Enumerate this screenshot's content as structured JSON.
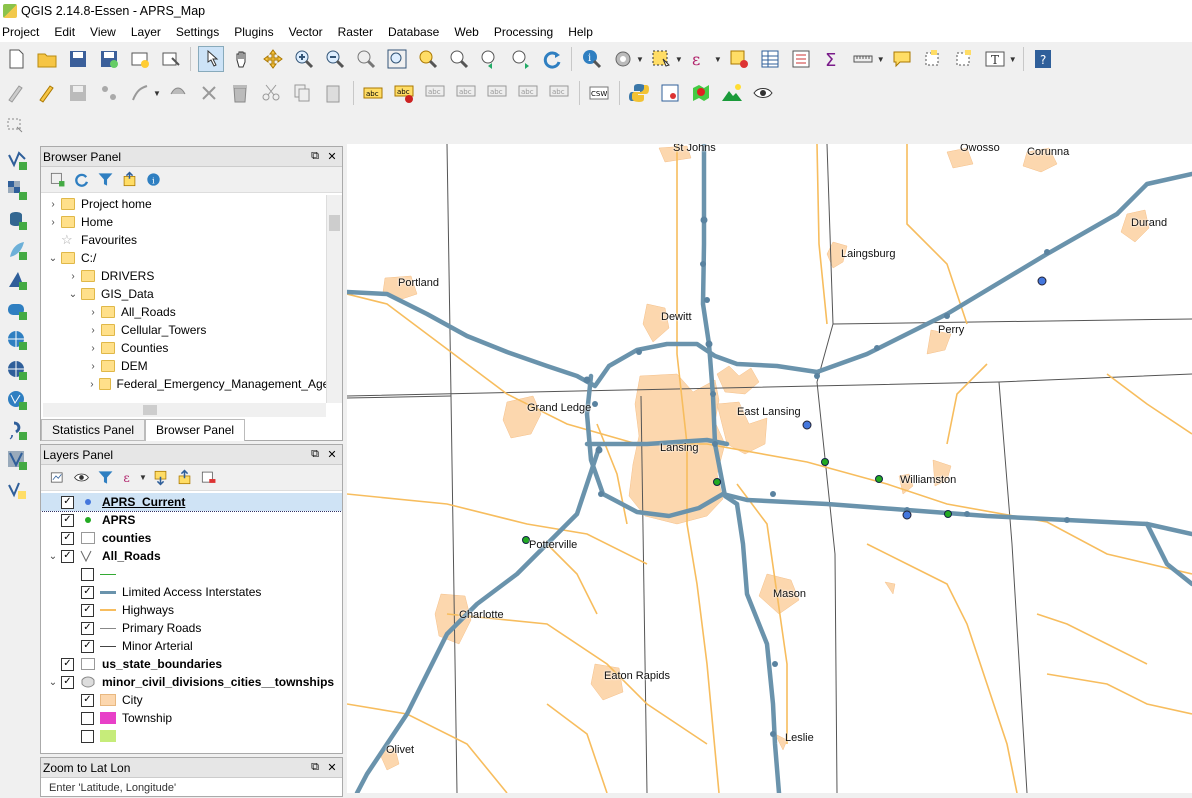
{
  "window": {
    "title": "QGIS 2.14.8-Essen - APRS_Map"
  },
  "menu": [
    "Project",
    "Edit",
    "View",
    "Layer",
    "Settings",
    "Plugins",
    "Vector",
    "Raster",
    "Database",
    "Web",
    "Processing",
    "Help"
  ],
  "browser_panel": {
    "title": "Browser Panel",
    "items": [
      {
        "label": "Project home",
        "level": 0,
        "expand": ">"
      },
      {
        "label": "Home",
        "level": 0,
        "expand": ">"
      },
      {
        "label": "Favourites",
        "level": 0,
        "expand": ""
      },
      {
        "label": "C:/",
        "level": 0,
        "expand": "v"
      },
      {
        "label": "DRIVERS",
        "level": 1,
        "expand": ">"
      },
      {
        "label": "GIS_Data",
        "level": 1,
        "expand": "v"
      },
      {
        "label": "All_Roads",
        "level": 2,
        "expand": ">"
      },
      {
        "label": "Cellular_Towers",
        "level": 2,
        "expand": ">"
      },
      {
        "label": "Counties",
        "level": 2,
        "expand": ">"
      },
      {
        "label": "DEM",
        "level": 2,
        "expand": ">"
      },
      {
        "label": "Federal_Emergency_Management_Agenc",
        "level": 2,
        "expand": ">"
      }
    ],
    "tabs": [
      "Statistics Panel",
      "Browser Panel"
    ]
  },
  "layers_panel": {
    "title": "Layers Panel",
    "items": [
      {
        "label": "APRS_Current",
        "level": 0,
        "bold": true,
        "checked": true,
        "expand": "",
        "sym": "blue-dot",
        "selected": true
      },
      {
        "label": "APRS",
        "level": 0,
        "bold": true,
        "checked": true,
        "expand": "",
        "sym": "green-dot"
      },
      {
        "label": "counties",
        "level": 0,
        "bold": true,
        "checked": true,
        "expand": "",
        "sym": "empty-box"
      },
      {
        "label": "All_Roads",
        "level": 0,
        "bold": true,
        "checked": true,
        "expand": "v",
        "sym": "line-icon"
      },
      {
        "label": "",
        "level": 1,
        "bold": false,
        "checked": false,
        "expand": "",
        "sym": "thin-green-line"
      },
      {
        "label": "Limited Access Interstates",
        "level": 1,
        "bold": false,
        "checked": true,
        "expand": "",
        "sym": "thick-blue-line"
      },
      {
        "label": "Highways",
        "level": 1,
        "bold": false,
        "checked": true,
        "expand": "",
        "sym": "orange-line"
      },
      {
        "label": "Primary Roads",
        "level": 1,
        "bold": false,
        "checked": true,
        "expand": "",
        "sym": "gray-line"
      },
      {
        "label": "Minor Arterial",
        "level": 1,
        "bold": false,
        "checked": true,
        "expand": "",
        "sym": "dark-line"
      },
      {
        "label": "us_state_boundaries",
        "level": 0,
        "bold": true,
        "checked": true,
        "expand": "",
        "sym": "empty-box"
      },
      {
        "label": "minor_civil_divisions_cities__townships",
        "level": 0,
        "bold": true,
        "checked": true,
        "expand": "v",
        "sym": "poly-icon"
      },
      {
        "label": "City",
        "level": 1,
        "bold": false,
        "checked": true,
        "expand": "",
        "sym": "peach-fill"
      },
      {
        "label": "Township",
        "level": 1,
        "bold": false,
        "checked": false,
        "expand": "",
        "sym": "magenta-fill"
      },
      {
        "label": "",
        "level": 1,
        "bold": false,
        "checked": false,
        "expand": "",
        "sym": "lime-fill"
      }
    ]
  },
  "zoom_panel": {
    "title": "Zoom to Lat Lon",
    "hint": "Enter 'Latitude, Longitude'"
  },
  "map": {
    "colors": {
      "interstate": "#6a93ac",
      "highway": "#f7bd5e",
      "city": "#fcd7ae",
      "boundary": "#606060"
    },
    "places": [
      "St Johns",
      "Owosso",
      "Corunna",
      "Durand",
      "Laingsburg",
      "Portland",
      "Dewitt",
      "Perry",
      "East Lansing",
      "Grand Ledge",
      "Lansing",
      "Williamston",
      "Potterville",
      "Charlotte",
      "Mason",
      "Eaton Rapids",
      "Leslie",
      "Olivet"
    ]
  }
}
